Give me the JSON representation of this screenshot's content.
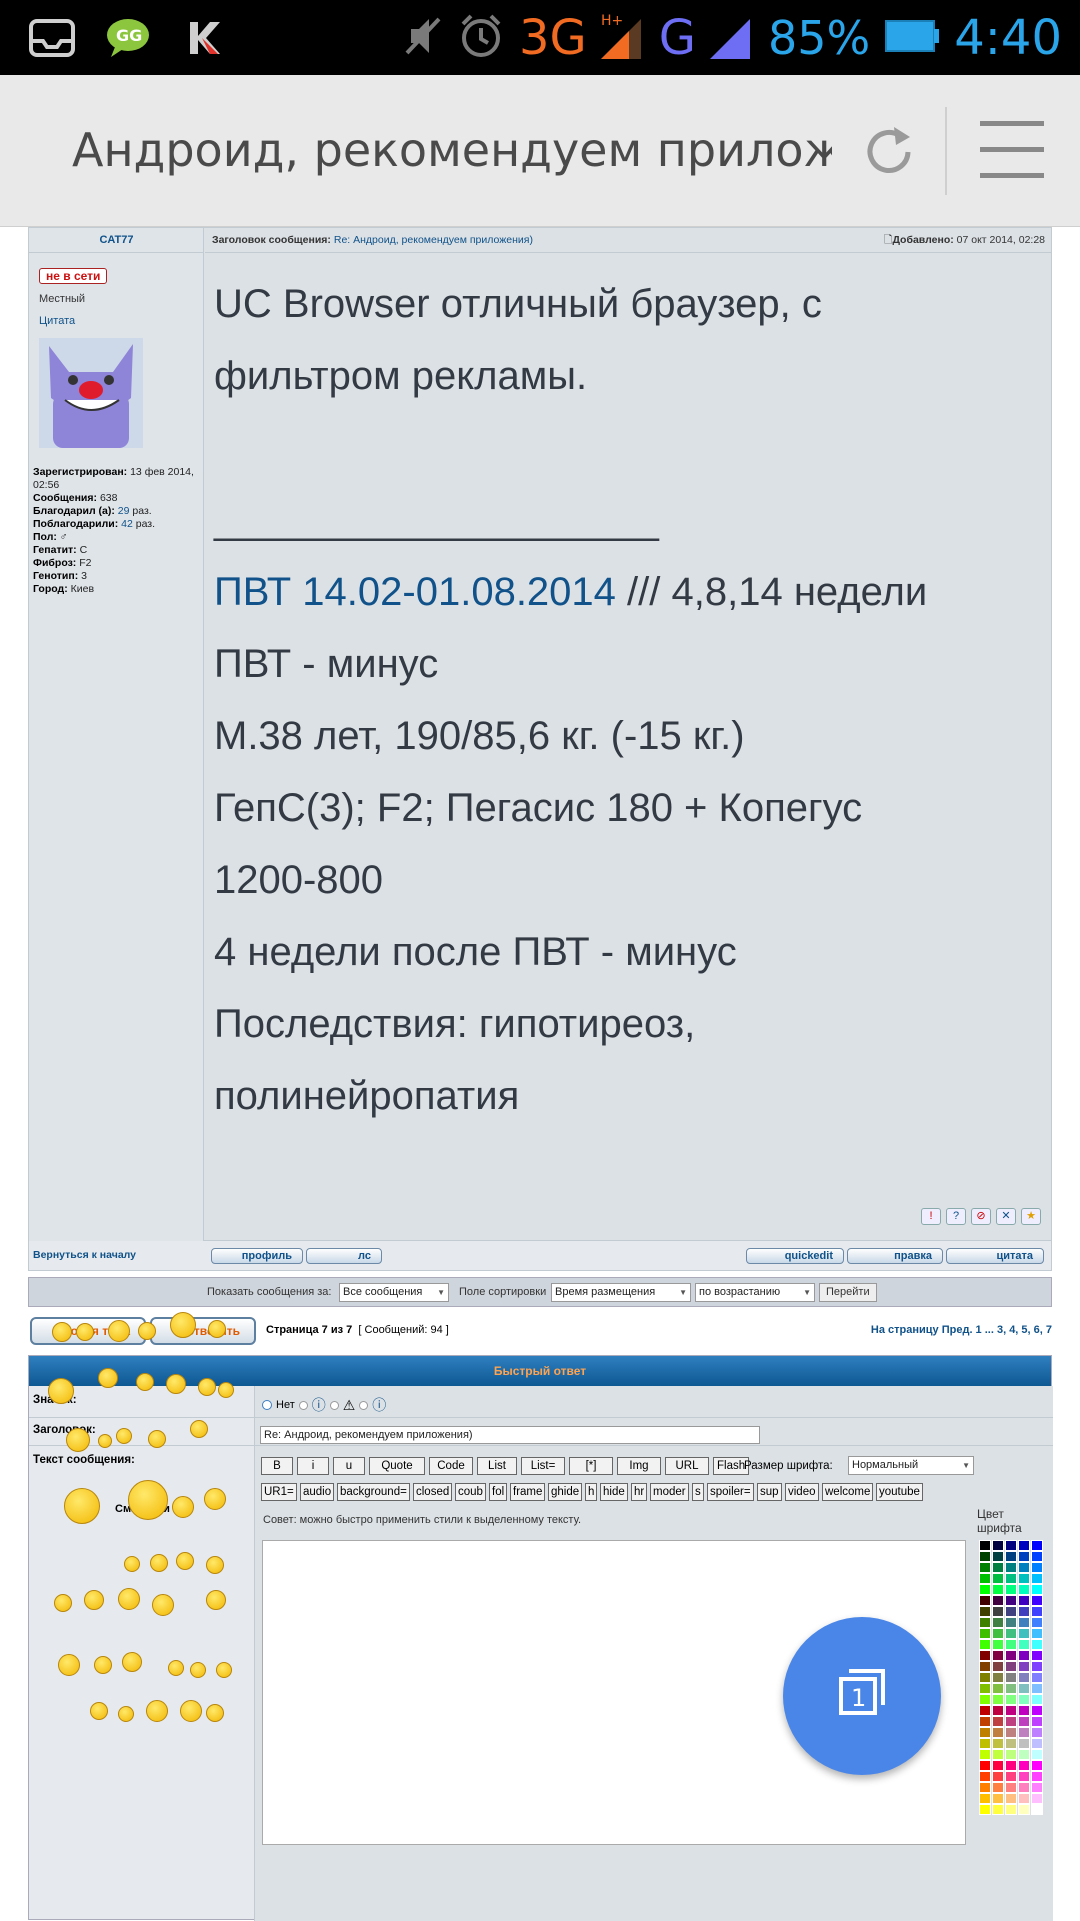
{
  "statusbar": {
    "network_3g": "3G",
    "network_h": "H+",
    "network_g": "G",
    "battery": "85%",
    "time": "4:40"
  },
  "browser": {
    "title": "Андроид, рекомендуем приложен"
  },
  "post": {
    "author": "CAT77",
    "status_badge": "не в сети",
    "rank": "Местный",
    "quote_link": "Цитата",
    "registered_label": "Зарегистрирован:",
    "registered_value": "13 фев 2014, 02:56",
    "messages_label": "Сообщения:",
    "messages_value": "638",
    "thanked_label": "Благодарил (а):",
    "thanked_value": "29",
    "thanked_suffix": "раз.",
    "thanked_by_label": "Поблагодарили:",
    "thanked_by_value": "42",
    "thanked_by_suffix": "раз.",
    "sex_label": "Пол:",
    "sex_value": "♂",
    "hepatitis_label": "Гепатит:",
    "hepatitis_value": "C",
    "fibrosis_label": "Фиброз:",
    "fibrosis_value": "F2",
    "genotype_label": "Генотип:",
    "genotype_value": "3",
    "city_label": "Город:",
    "city_value": "Киев",
    "subject_label": "Заголовок сообщения:",
    "subject_value": "Re: Андроид, рекомендуем приложения)",
    "added_label": "Добавлено:",
    "added_value": "07 окт 2014, 02:28",
    "body_line1": "UC Browser отличный браузер, с",
    "body_line2": "фильтром рекламы.",
    "signature_sep": "____________________",
    "sig_link": "ПВТ 14.02-01.08.2014",
    "sig_line1_rest": " /// 4,8,14 недели",
    "sig_line2": "ПВТ - минус",
    "sig_line3": "М.38 лет, 190/85,6 кг. (-15 кг.)",
    "sig_line4": "ГепС(3); F2; Пегасис 180 + Копегус",
    "sig_line5": "1200-800",
    "sig_line6": "4 недели после ПВТ - минус",
    "sig_line7": "Последствия: гипотиреоз,",
    "sig_line8": "полинейропатия",
    "back_to_top": "Вернуться к началу",
    "btn_profile": "профиль",
    "btn_pm": "лс",
    "btn_quickedit": "quickedit",
    "btn_edit": "правка",
    "btn_quote": "цитата",
    "post_icons": [
      "!",
      "?",
      "⊘",
      "✕",
      "★"
    ]
  },
  "sortbar": {
    "show_label": "Показать сообщения за:",
    "show_value": "Все сообщения",
    "sort_label": "Поле сортировки",
    "sort_value": "Время размещения",
    "order_value": "по возрастанию",
    "go": "Перейти"
  },
  "actions": {
    "new_topic": "новая тема",
    "reply": "ответить",
    "page_prefix": "Страница",
    "page_current": "7",
    "page_of": "из",
    "page_total": "7",
    "messages_count": "[ Сообщений: 94 ]",
    "pagenav": "На страницу Пред.  1 ... 3, 4, 5, 6, 7"
  },
  "quick_reply": {
    "title": "Быстрый ответ",
    "icon_label": "Значок:",
    "icon_none": "Нет",
    "subject_label": "Заголовок:",
    "subject_value": "Re: Андроид, рекомендуем приложения)",
    "text_label": "Текст сообщения:",
    "smilies_label": "Смайлики",
    "format_buttons_row1": [
      "B",
      "i",
      "u",
      "Quote",
      "Code",
      "List",
      "List=",
      "[*]",
      "Img",
      "URL",
      "Flash"
    ],
    "font_size_label": "Размер шрифта:",
    "font_size_value": "Нормальный",
    "format_buttons_row2": [
      "UR1=",
      "audio",
      "background=",
      "closed",
      "coub",
      "fol",
      "frame",
      "ghide",
      "h",
      "hide",
      "hr",
      "moder",
      "s",
      "spoiler=",
      "sup",
      "video",
      "welcome",
      "youtube"
    ],
    "tip": "Совет: можно быстро применить стили к выделенному тексту.",
    "color_label": "Цвет шрифта",
    "fab_label": "1"
  },
  "palette_colors": [
    "#000000",
    "#000040",
    "#000080",
    "#0000bf",
    "#0000ff",
    "#004000",
    "#004040",
    "#004080",
    "#0040bf",
    "#0040ff",
    "#008000",
    "#008040",
    "#008080",
    "#0080bf",
    "#0080ff",
    "#00bf00",
    "#00bf40",
    "#00bf80",
    "#00bfbf",
    "#00bfff",
    "#00ff00",
    "#00ff40",
    "#00ff80",
    "#00ffbf",
    "#00ffff",
    "#400000",
    "#400040",
    "#400080",
    "#4000bf",
    "#4000ff",
    "#404000",
    "#404040",
    "#404080",
    "#4040bf",
    "#4040ff",
    "#408000",
    "#408040",
    "#408080",
    "#4080bf",
    "#4080ff",
    "#40bf00",
    "#40bf40",
    "#40bf80",
    "#40bfbf",
    "#40bfff",
    "#40ff00",
    "#40ff40",
    "#40ff80",
    "#40ffbf",
    "#40ffff",
    "#800000",
    "#800040",
    "#800080",
    "#8000bf",
    "#8000ff",
    "#804000",
    "#804040",
    "#804080",
    "#8040bf",
    "#8040ff",
    "#808000",
    "#808040",
    "#808080",
    "#8080bf",
    "#8080ff",
    "#80bf00",
    "#80bf40",
    "#80bf80",
    "#80bfbf",
    "#80bfff",
    "#80ff00",
    "#80ff40",
    "#80ff80",
    "#80ffbf",
    "#80ffff",
    "#bf0000",
    "#bf0040",
    "#bf0080",
    "#bf00bf",
    "#bf00ff",
    "#bf4000",
    "#bf4040",
    "#bf4080",
    "#bf40bf",
    "#bf40ff",
    "#bf8000",
    "#bf8040",
    "#bf8080",
    "#bf80bf",
    "#bf80ff",
    "#bfbf00",
    "#bfbf40",
    "#bfbf80",
    "#bfbfbf",
    "#bfbfff",
    "#bfff00",
    "#bfff40",
    "#bfff80",
    "#bfffbf",
    "#bfffff",
    "#ff0000",
    "#ff0040",
    "#ff0080",
    "#ff00bf",
    "#ff00ff",
    "#ff4000",
    "#ff4040",
    "#ff4080",
    "#ff40bf",
    "#ff40ff",
    "#ff8000",
    "#ff8040",
    "#ff8080",
    "#ff80bf",
    "#ff80ff",
    "#ffbf00",
    "#ffbf40",
    "#ffbf80",
    "#ffbfbf",
    "#ffbfff",
    "#ffff00",
    "#ffff40",
    "#ffff80",
    "#ffffbf",
    "#ffffff"
  ]
}
